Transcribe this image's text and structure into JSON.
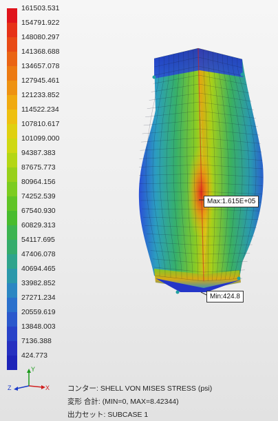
{
  "legend": {
    "values": [
      "161503.531",
      "154791.922",
      "148080.297",
      "141368.688",
      "134657.078",
      "127945.461",
      "121233.852",
      "114522.234",
      "107810.617",
      "101099.000",
      "94387.383",
      "87675.773",
      "80964.156",
      "74252.539",
      "67540.930",
      "60829.313",
      "54117.695",
      "47406.078",
      "40694.465",
      "33982.852",
      "27271.234",
      "20559.619",
      "13848.003",
      "7136.388",
      "424.773"
    ],
    "colors": [
      "#e0141c",
      "#e63218",
      "#e84a16",
      "#ea6414",
      "#ec7a12",
      "#ee9212",
      "#f0aa10",
      "#eec010",
      "#e0d010",
      "#cfd812",
      "#b4d614",
      "#98d01a",
      "#7ccc20",
      "#60c426",
      "#48bc2e",
      "#3cb450",
      "#34ac6c",
      "#2ea48c",
      "#2a98aa",
      "#2a86c2",
      "#2a70cc",
      "#2a58cc",
      "#2842c8",
      "#2630c0",
      "#1e24b8"
    ]
  },
  "callouts": {
    "max": "Max:1.615E+05",
    "min": "Min:424.8"
  },
  "axis": {
    "x": "X",
    "y": "Y",
    "z": "Z"
  },
  "info": {
    "line1": "コンター: SHELL VON MISES STRESS (psi)",
    "line2": "変形 合計: (MIN=0, MAX=8.42344)",
    "line3": "出力セット: SUBCASE 1"
  }
}
